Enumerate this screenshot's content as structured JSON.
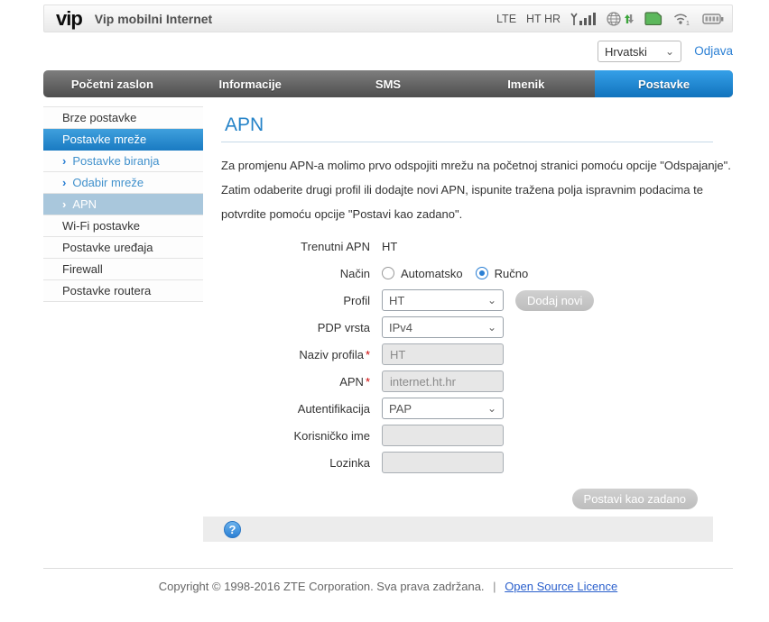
{
  "header": {
    "logo": "vip",
    "title": "Vip mobilni Internet",
    "status": {
      "network_type": "LTE",
      "operator": "HT HR",
      "wifi_count": "1",
      "icons": [
        "signal-icon",
        "globe-traffic-icon",
        "sim-icon",
        "wifi-icon",
        "battery-icon"
      ]
    }
  },
  "toolbar": {
    "language": "Hrvatski",
    "logout_label": "Odjava"
  },
  "icons": {
    "chevron_down": "⌄",
    "sub_arrow": "›",
    "help": "?"
  },
  "nav": {
    "tabs": [
      {
        "label": "Početni zaslon",
        "active": false
      },
      {
        "label": "Informacije",
        "active": false
      },
      {
        "label": "SMS",
        "active": false
      },
      {
        "label": "Imenik",
        "active": false
      },
      {
        "label": "Postavke",
        "active": true
      }
    ]
  },
  "sidebar": {
    "items": [
      {
        "label": "Brze postavke",
        "type": "top",
        "state": "normal"
      },
      {
        "label": "Postavke mreže",
        "type": "top",
        "state": "active"
      },
      {
        "label": "Postavke biranja",
        "type": "sub",
        "state": "normal"
      },
      {
        "label": "Odabir mreže",
        "type": "sub",
        "state": "normal"
      },
      {
        "label": "APN",
        "type": "sub",
        "state": "active"
      },
      {
        "label": "Wi-Fi postavke",
        "type": "top",
        "state": "normal"
      },
      {
        "label": "Postavke uređaja",
        "type": "top",
        "state": "normal"
      },
      {
        "label": "Firewall",
        "type": "top",
        "state": "normal"
      },
      {
        "label": "Postavke routera",
        "type": "top",
        "state": "normal"
      }
    ]
  },
  "main": {
    "title": "APN",
    "description_lines": [
      "Za promjenu APN-a molimo prvo odspojiti mrežu na početnoj stranici pomoću opcije \"Odspajanje\".",
      "Zatim odaberite drugi profil ili dodajte novi APN, ispunite tražena polja ispravnim podacima te",
      "potvrdite pomoću opcije \"Postavi kao zadano\"."
    ],
    "form": {
      "current_apn": {
        "label": "Trenutni APN",
        "value": "HT"
      },
      "mode": {
        "label": "Način",
        "options": [
          {
            "label": "Automatsko",
            "selected": false
          },
          {
            "label": "Ručno",
            "selected": true
          }
        ]
      },
      "profile": {
        "label": "Profil",
        "value": "HT",
        "button": "Dodaj novi"
      },
      "pdp_type": {
        "label": "PDP vrsta",
        "value": "IPv4"
      },
      "profile_name": {
        "label": "Naziv profila",
        "required": "*",
        "value": "HT"
      },
      "apn": {
        "label": "APN",
        "required": "*",
        "value": "internet.ht.hr"
      },
      "auth": {
        "label": "Autentifikacija",
        "value": "PAP"
      },
      "username": {
        "label": "Korisničko ime",
        "value": ""
      },
      "password": {
        "label": "Lozinka",
        "value": ""
      },
      "submit_label": "Postavi kao zadano"
    }
  },
  "footer": {
    "copyright": "Copyright © 1998-2016 ZTE Corporation. Sva prava zadržana.",
    "separator": "|",
    "license_link": "Open Source Licence"
  },
  "colors": {
    "accent_blue": "#2a7fd4",
    "active_tab_top": "#35a0e8",
    "active_tab_bottom": "#1173bd",
    "nav_gray_top": "#7e7e7e",
    "nav_gray_bottom": "#4e4e4e",
    "sidebar_sub_active_bg": "#a9c7dc",
    "sim_green": "#5cb85c",
    "traffic_green": "#3aa53a",
    "required_red": "#cc0000",
    "link_blue": "#2a5fcc"
  }
}
